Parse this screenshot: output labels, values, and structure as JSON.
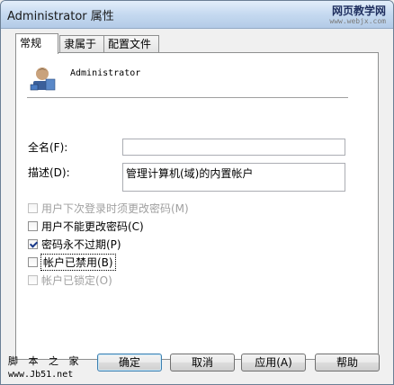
{
  "window": {
    "title": "Administrator 属性"
  },
  "watermark": {
    "top_line1": "网页教学网",
    "top_line2": "www.webjx.com",
    "bottom_line1": "脚 本 之 家",
    "bottom_line2": "www.Jb51.net"
  },
  "tabs": [
    {
      "label": "常规",
      "active": true
    },
    {
      "label": "隶属于",
      "active": false
    },
    {
      "label": "配置文件",
      "active": false
    }
  ],
  "user": {
    "name": "Administrator",
    "icon": "user-icon"
  },
  "form": {
    "fullname_label": "全名(F):",
    "fullname_value": "",
    "description_label": "描述(D):",
    "description_value": "管理计算机(域)的内置帐户"
  },
  "checkboxes": [
    {
      "label": "用户下次登录时须更改密码(M)",
      "checked": false,
      "enabled": false
    },
    {
      "label": "用户不能更改密码(C)",
      "checked": false,
      "enabled": true
    },
    {
      "label": "密码永不过期(P)",
      "checked": true,
      "enabled": true
    },
    {
      "label": "帐户已禁用(B)",
      "checked": false,
      "enabled": true
    },
    {
      "label": "帐户已锁定(O)",
      "checked": false,
      "enabled": false
    }
  ],
  "buttons": {
    "ok": "确定",
    "cancel": "取消",
    "apply": "应用(A)",
    "help": "帮助"
  }
}
